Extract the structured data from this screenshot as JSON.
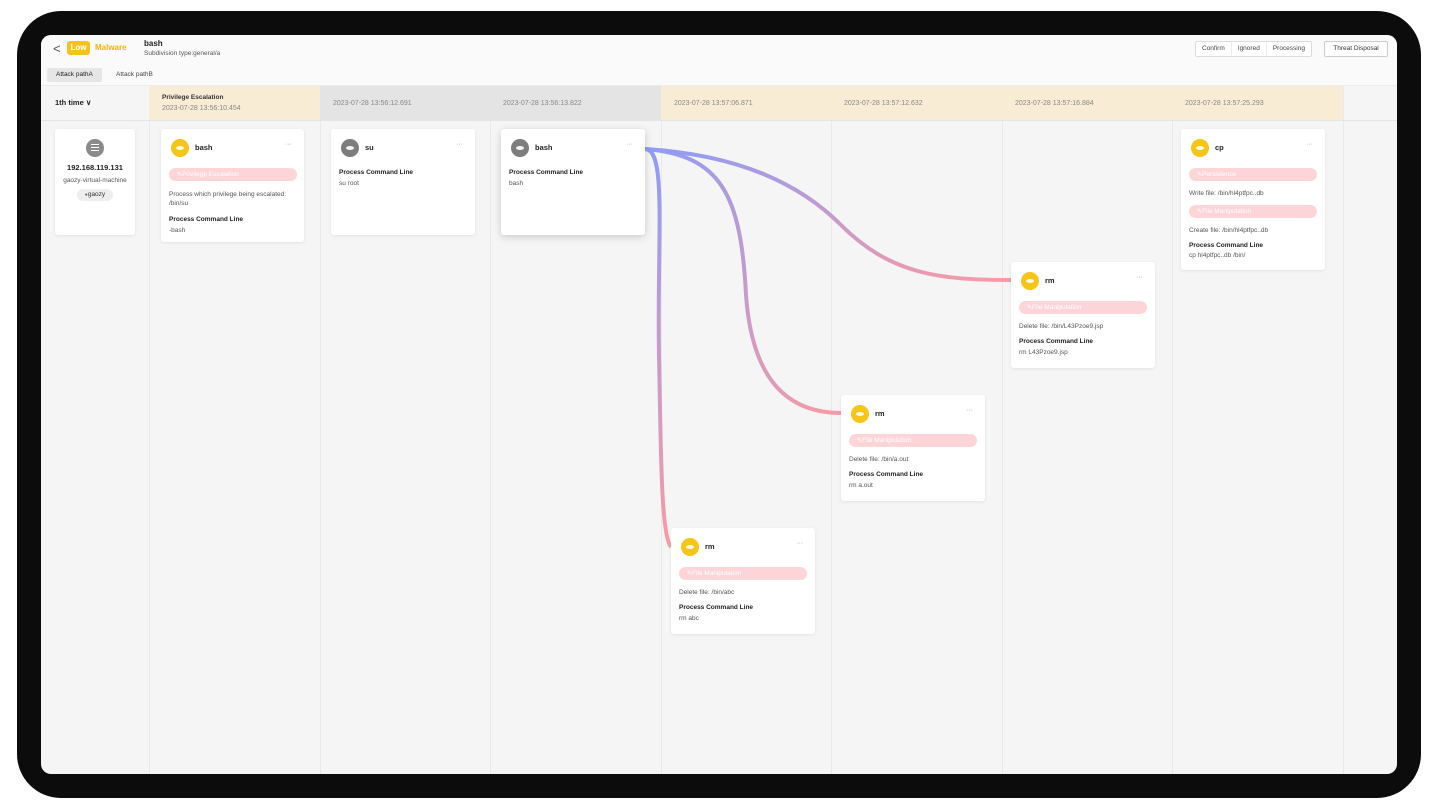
{
  "header": {
    "back_glyph": "<",
    "severity": "Low",
    "category": "Malware",
    "process": "bash",
    "subdivision": "Subdivision type:general/a",
    "status_buttons": [
      "Confirm",
      "Ignored",
      "Processing"
    ],
    "threat_disposal": "Threat Disposal"
  },
  "tabs": [
    "Attack pathA",
    "Attack pathB"
  ],
  "time_selector": "1th time ∨",
  "columns": [
    {
      "name": "Privilege Escalation",
      "time": "2023-07-28 13:56:10.454",
      "color": "#f8ecd4"
    },
    {
      "name": "",
      "time": "2023-07-28 13:56:12.691",
      "color": "#e4e4e4"
    },
    {
      "name": "",
      "time": "2023-07-28 13:56:13.822",
      "color": "#e4e4e4"
    },
    {
      "name": "",
      "time": "2023-07-28 13:57:06.871",
      "color": "#f8ecd4"
    },
    {
      "name": "",
      "time": "2023-07-28 13:57:12.632",
      "color": "#f8ecd4"
    },
    {
      "name": "",
      "time": "2023-07-28 13:57:16.884",
      "color": "#f8ecd4"
    },
    {
      "name": "",
      "time": "2023-07-28 13:57:25.293",
      "color": "#f8ecd4"
    }
  ],
  "host": {
    "ip": "192.168.119.131",
    "hostname": "gaozy-virtual-machine",
    "user": "gaozy"
  },
  "nodes": {
    "bash1": {
      "title": "bash",
      "tag": "Privilege Escalation",
      "desc": "Process which privilege being escalated:",
      "desc_value": "/bin/su",
      "cmd_label": "Process Command Line",
      "cmd": "-bash"
    },
    "su": {
      "title": "su",
      "cmd_label": "Process Command Line",
      "cmd": "su root"
    },
    "bash2": {
      "title": "bash",
      "cmd_label": "Process Command Line",
      "cmd": "bash"
    },
    "rm_abc": {
      "title": "rm",
      "tag": "File Manipulation",
      "desc": "Delete file: /bin/abc",
      "cmd_label": "Process Command Line",
      "cmd": "rm abc"
    },
    "rm_aout": {
      "title": "rm",
      "tag": "File Manipulation",
      "desc": "Delete file: /bin/a.out",
      "cmd_label": "Process Command Line",
      "cmd": "rm a.out"
    },
    "rm_jsp": {
      "title": "rm",
      "tag": "File Manipulation",
      "desc": "Delete file: /bin/L43Pzoe9.jsp",
      "cmd_label": "Process Command Line",
      "cmd": "rm L43Pzoe9.jsp"
    },
    "cp": {
      "title": "cp",
      "tag": "Persistence",
      "desc": "Write file: /bin/hl4ptfpc..db",
      "tag2": "File Manipulation",
      "desc2": "Create file: /bin/hl4ptfpc..db",
      "cmd_label": "Process Command Line",
      "cmd": "cp hl4ptfpc..db /bin/"
    }
  },
  "menu_glyph": "···",
  "colors": {
    "severity_low": "#f7c31a",
    "tag_bg": "#fdd5d8",
    "link_start": "#8f9cf5",
    "link_end": "#f99aa5"
  }
}
